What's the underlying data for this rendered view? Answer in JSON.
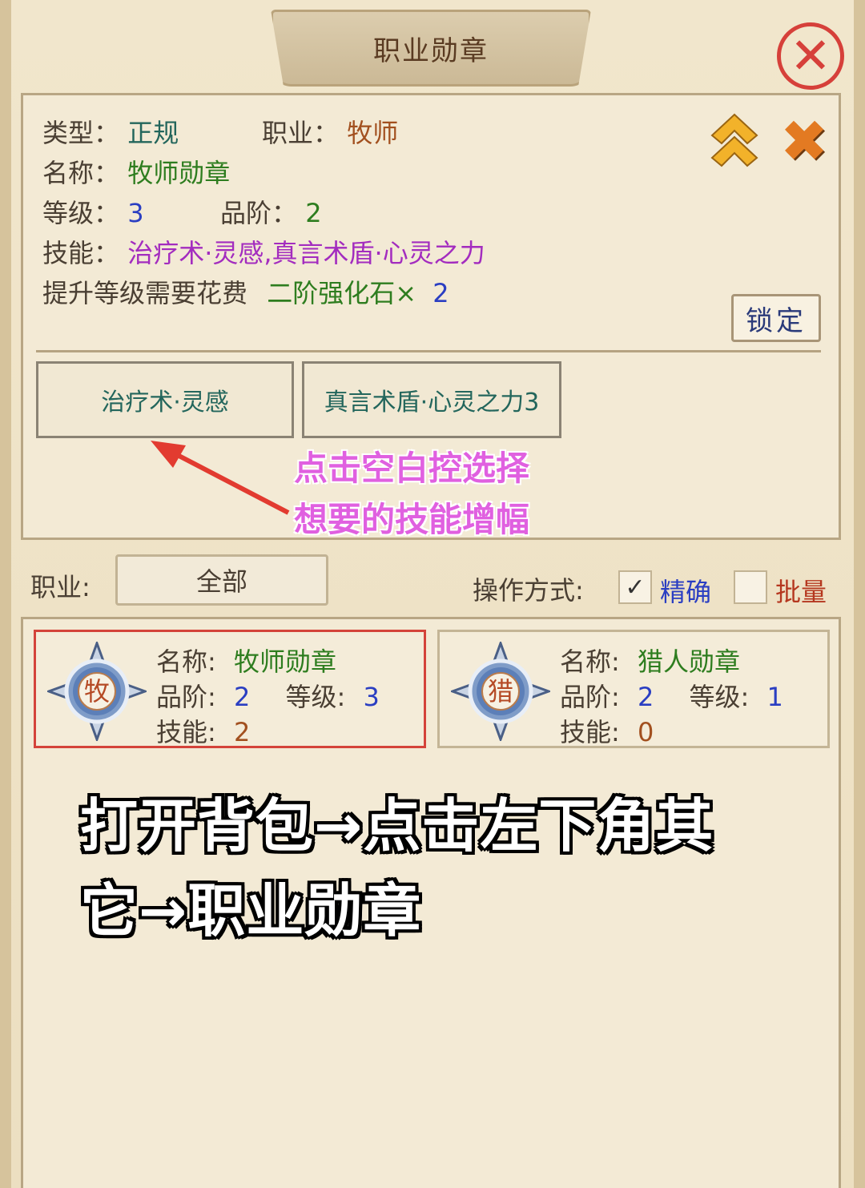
{
  "window": {
    "title": "职业勋章"
  },
  "detail": {
    "type_label": "类型：",
    "type_value": "正规",
    "class_label": "职业：",
    "class_value": "牧师",
    "name_label": "名称：",
    "name_value": "牧师勋章",
    "level_label": "等级：",
    "level_value": "3",
    "grade_label": "品阶：",
    "grade_value": "2",
    "skills_label": "技能：",
    "skills_value": "治疗术·灵感,真言术盾·心灵之力",
    "upgrade_cost_label": "提升等级需要花费",
    "upgrade_item": "二阶强化石×",
    "upgrade_qty": "2",
    "lock_label": "锁定"
  },
  "skill_slots": [
    {
      "label": "治疗术·灵感"
    },
    {
      "label": "真言术盾·心灵之力3"
    }
  ],
  "hint": {
    "line1": "点击空白控选择",
    "line2": "想要的技能增幅"
  },
  "filter": {
    "class_label": "职业:",
    "class_selected": "全部",
    "mode_label": "操作方式:",
    "mode_precise": "精确",
    "mode_batch": "批量",
    "precise_checked": "✓"
  },
  "medals": [
    {
      "char": "牧",
      "name_label": "名称:",
      "name": "牧师勋章",
      "grade_label": "品阶:",
      "grade": "2",
      "level_label": "等级:",
      "level": "3",
      "skills_label": "技能:",
      "skills": "2"
    },
    {
      "char": "猎",
      "name_label": "名称:",
      "name": "猎人勋章",
      "grade_label": "品阶:",
      "grade": "2",
      "level_label": "等级:",
      "level": "1",
      "skills_label": "技能:",
      "skills": "0"
    }
  ],
  "instructions": {
    "line1": "打开背包→点击左下角其",
    "line2": "它→职业勋章"
  },
  "colors": {
    "accent_red": "#d6403a",
    "hint_pink": "#e060e0",
    "value_teal": "#23665c",
    "value_blue": "#2a3ec2",
    "value_purple": "#a32cbf"
  },
  "icons": {
    "close": "close-circle-icon",
    "upgrade": "double-chevron-up-icon",
    "remove": "orange-x-icon"
  }
}
